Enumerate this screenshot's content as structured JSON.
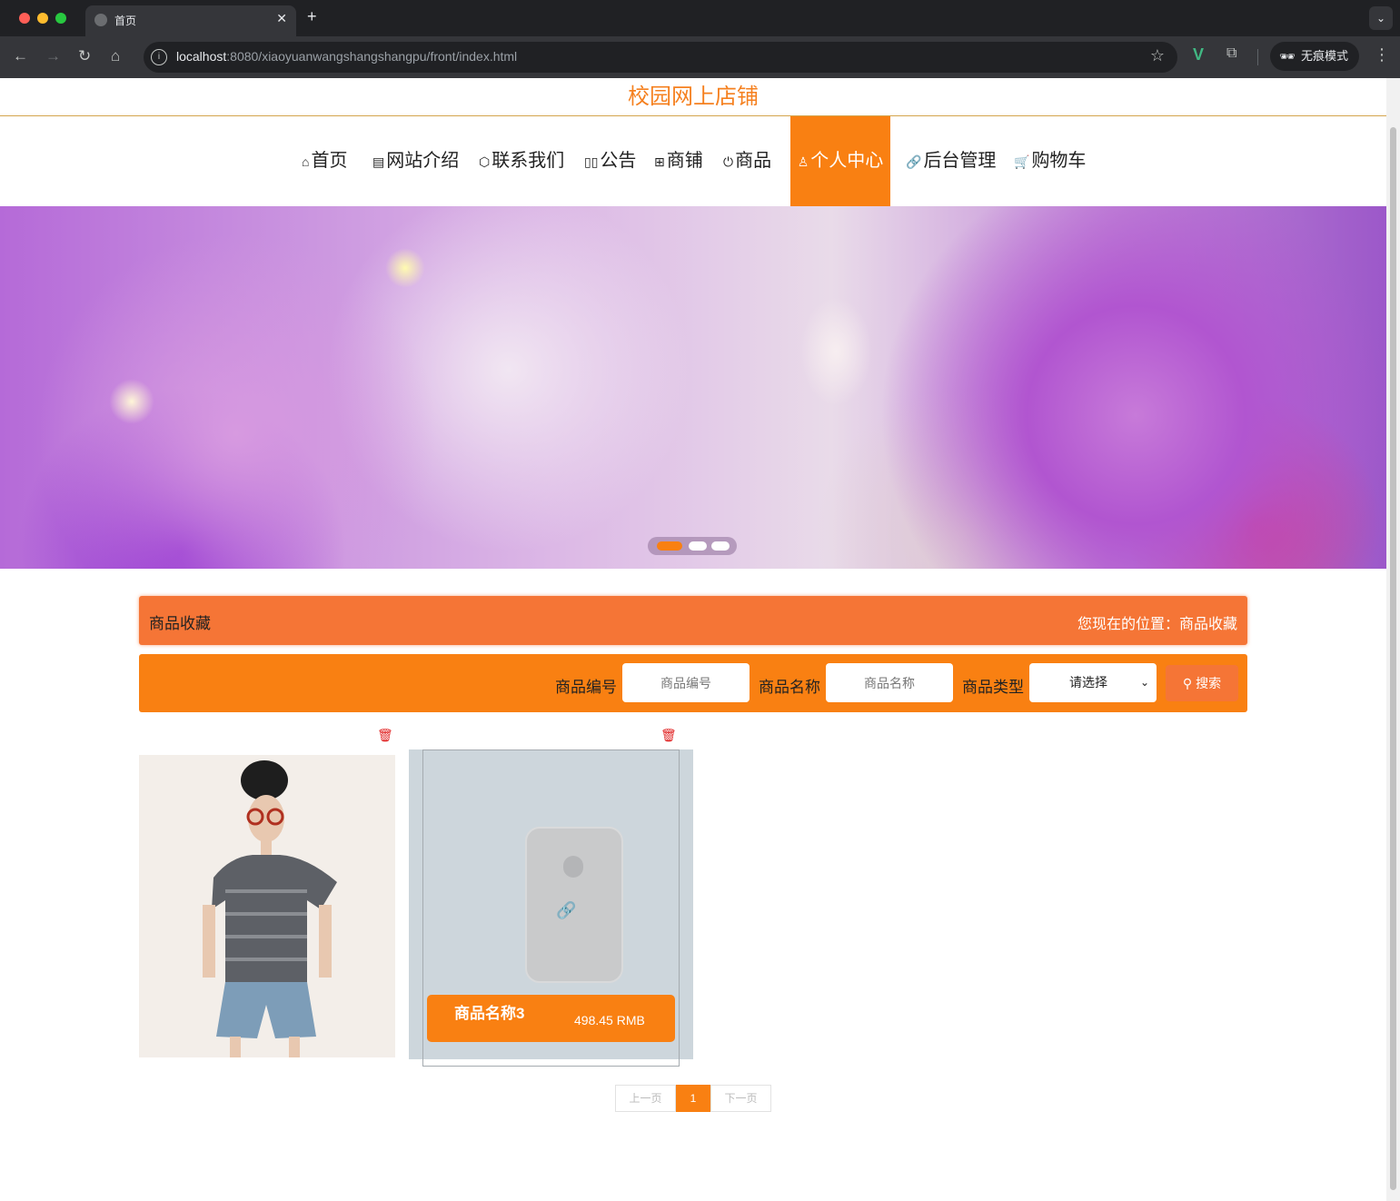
{
  "browser": {
    "tab_title": "首页",
    "url_host": "localhost",
    "url_rest": ":8080/xiaoyuanwangshangshangpu/front/index.html",
    "incognito_label": "无痕模式"
  },
  "site": {
    "title": "校园网上店铺"
  },
  "nav": {
    "items": [
      {
        "label": "首页",
        "icon": "home-icon"
      },
      {
        "label": "网站介绍",
        "icon": "clipboard-icon"
      },
      {
        "label": "联系我们",
        "icon": "box-icon"
      },
      {
        "label": "公告",
        "icon": "book-icon"
      },
      {
        "label": "商铺",
        "icon": "gift-icon"
      },
      {
        "label": "商品",
        "icon": "power-icon"
      },
      {
        "label": "个人中心",
        "icon": "user-icon",
        "active": true
      },
      {
        "label": "后台管理",
        "icon": "link-icon"
      },
      {
        "label": "购物车",
        "icon": "cart-icon"
      }
    ]
  },
  "carousel": {
    "slide_count": 3,
    "active_index": 0
  },
  "page_title": {
    "left": "商品收藏",
    "location_prefix": "您现在的位置：",
    "location": "商品收藏"
  },
  "search": {
    "fields": [
      {
        "label": "商品编号",
        "placeholder": "商品编号"
      },
      {
        "label": "商品名称",
        "placeholder": "商品名称"
      }
    ],
    "type_label": "商品类型",
    "type_selected": "请选择",
    "button": "搜索"
  },
  "products": [
    {
      "name": "",
      "price": ""
    },
    {
      "name": "商品名称3",
      "price": "498.45 RMB"
    }
  ],
  "pagination": {
    "prev": "上一页",
    "current": "1",
    "next": "下一页"
  },
  "colors": {
    "accent": "#f98012",
    "title_bar": "#f57536",
    "delete": "#e02020"
  }
}
